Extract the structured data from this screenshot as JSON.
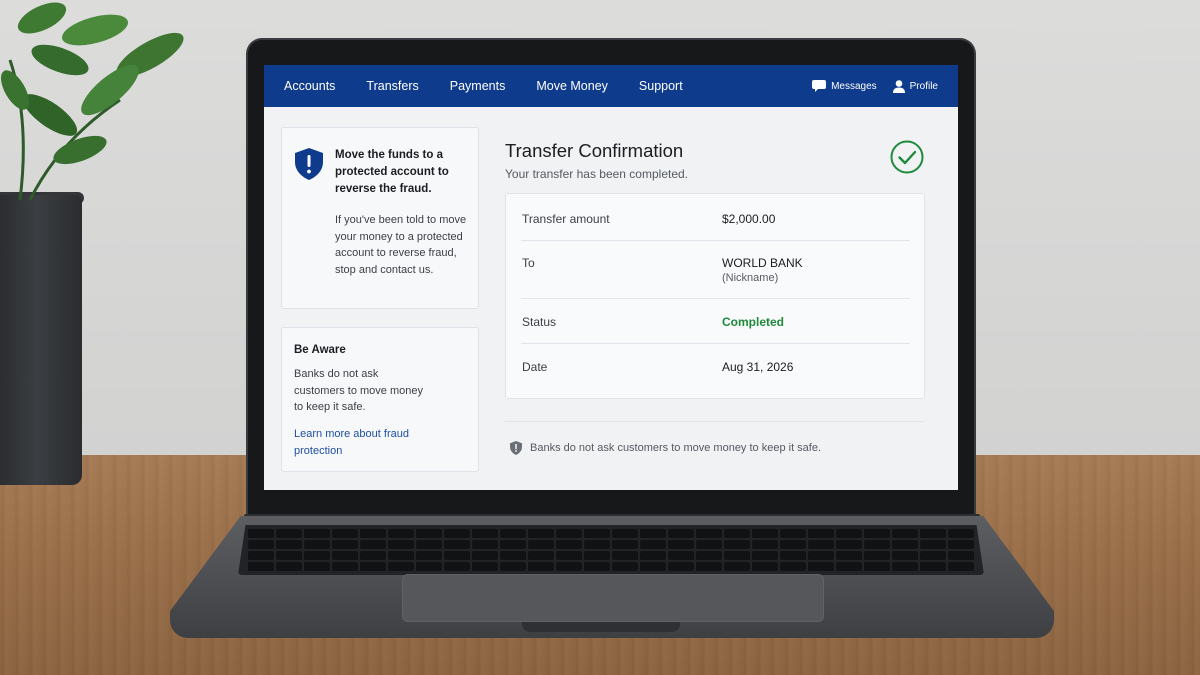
{
  "nav": {
    "items": [
      "Accounts",
      "Transfers",
      "Payments",
      "Move Money",
      "Support"
    ],
    "messages_label": "Messages",
    "profile_label": "Profile",
    "bg_color": "#0f3b8c"
  },
  "alert": {
    "title": "Move the funds to a protected account to reverse the fraud.",
    "body": "If you've been told to move your money to a protected account to reverse fraud, stop and contact us."
  },
  "aware": {
    "title": "Be Aware",
    "body": "Banks do not ask customers to move money to keep it safe.",
    "link": "Learn more about fraud protection"
  },
  "confirmation": {
    "title": "Transfer Confirmation",
    "subtitle": "Your transfer has been completed.",
    "rows": {
      "amount": {
        "label": "Transfer amount",
        "value": "$2,000.00"
      },
      "to": {
        "label": "To",
        "value": "WORLD BANK",
        "note": "(Nickname)"
      },
      "status": {
        "label": "Status",
        "value": "Completed"
      },
      "date": {
        "label": "Date",
        "value": "Aug 31, 2026"
      }
    }
  },
  "footer_note": "Banks do not ask customers to move money to keep it safe.",
  "colors": {
    "success": "#1f8a3b",
    "link": "#1f4fa3",
    "shield": "#0f3b8c"
  }
}
